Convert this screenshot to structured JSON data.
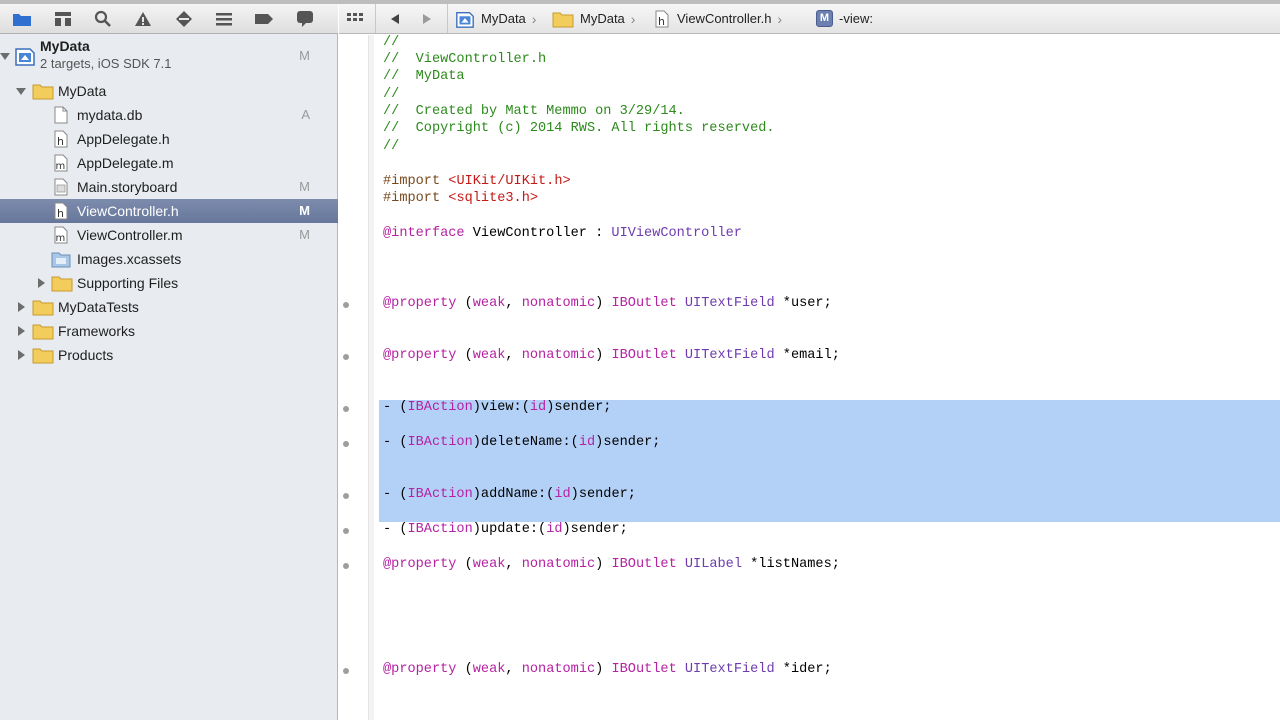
{
  "jump_bar": {
    "project": "MyData",
    "group": "MyData",
    "file": "ViewController.h",
    "symbol_badge": "M",
    "symbol": "-view:"
  },
  "navigator": {
    "project": {
      "name": "MyData",
      "subtitle": "2 targets, iOS SDK 7.1",
      "badge": "M"
    },
    "items": [
      {
        "label": "MyData",
        "badge": ""
      },
      {
        "label": "mydata.db",
        "badge": "A"
      },
      {
        "label": "AppDelegate.h",
        "badge": ""
      },
      {
        "label": "AppDelegate.m",
        "badge": ""
      },
      {
        "label": "Main.storyboard",
        "badge": "M"
      },
      {
        "label": "ViewController.h",
        "badge": "M"
      },
      {
        "label": "ViewController.m",
        "badge": "M"
      },
      {
        "label": "Images.xcassets",
        "badge": ""
      },
      {
        "label": "Supporting Files",
        "badge": ""
      },
      {
        "label": "MyDataTests",
        "badge": ""
      },
      {
        "label": "Frameworks",
        "badge": ""
      },
      {
        "label": "Products",
        "badge": ""
      }
    ]
  },
  "code": {
    "c1": "//",
    "c2": "//  ViewController.h",
    "c3": "//  MyData",
    "c4": "//",
    "c5": "//  Created by Matt Memmo on 3/29/14.",
    "c6": "//  Copyright (c) 2014 RWS. All rights reserved.",
    "c7": "//",
    "import_kw": "#import",
    "import1": "<UIKit/UIKit.h>",
    "import2": "<sqlite3.h>",
    "interface_kw": "@interface",
    "interface_name": " ViewController : ",
    "interface_super": "UIViewController",
    "property_kw": "@property",
    "attrs_open": " (",
    "weak": "weak",
    "comma": ", ",
    "nonatomic": "nonatomic",
    "attrs_close": ") ",
    "iboutlet": "IBOutlet",
    "uitextfield": " UITextField",
    "uilabel": " UILabel",
    "user": " *user;",
    "email": " *email;",
    "listnames": " *listNames;",
    "ider": " *ider;",
    "minus": "- (",
    "ibaction": "IBAction",
    "paren": ")",
    "view": "view:(",
    "deletename": "deleteName:(",
    "addname": "addName:(",
    "update": "update:(",
    "id": "id",
    "sender": ")sender;"
  },
  "colors": {
    "comment": "#2d8a1d",
    "keyword": "#b522a3",
    "string": "#c41a16",
    "class": "#6e3bb0",
    "selection": "#b3d1f7",
    "nav_selected": "#6f80a3"
  }
}
